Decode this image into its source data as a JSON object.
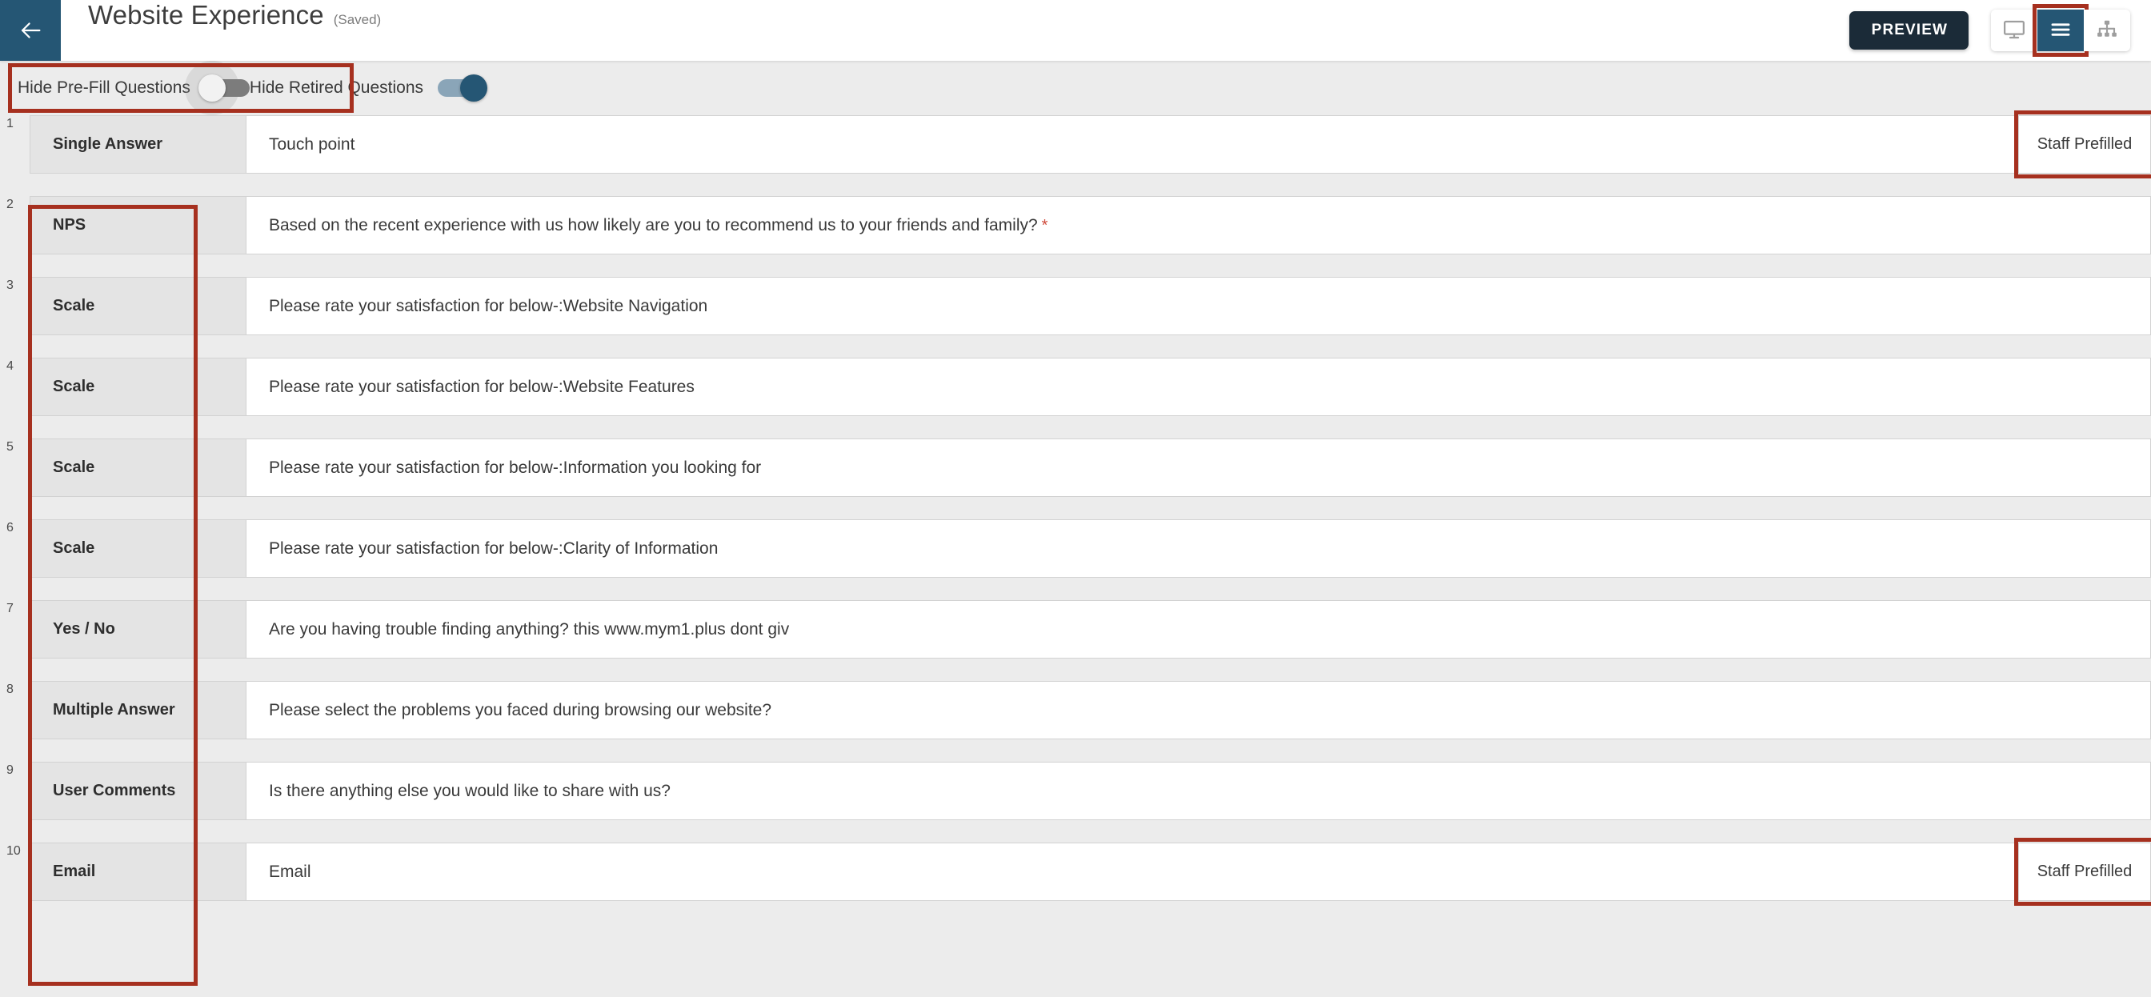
{
  "header": {
    "back_icon": "arrow-left-icon",
    "title": "Website Experience",
    "saved_status": "(Saved)",
    "preview_label": "PREVIEW",
    "view_modes": [
      {
        "name": "desktop-view",
        "icon": "monitor-icon",
        "active": false
      },
      {
        "name": "list-view",
        "icon": "hamburger-list-icon",
        "active": true
      },
      {
        "name": "flow-view",
        "icon": "sitemap-tree-icon",
        "active": false
      }
    ]
  },
  "filters": {
    "hide_prefill_label": "Hide Pre-Fill Questions",
    "hide_prefill_on": false,
    "hide_retired_label": "Hide Retired Questions",
    "hide_retired_on": true
  },
  "colors": {
    "brand_blue": "#255674",
    "preview_dark": "#1b2b38",
    "annotation_red": "#a6301f",
    "required_star": "#cf4b3c",
    "row_type_bg": "#e4e4e4",
    "page_bg": "#ececec"
  },
  "badges": {
    "staff_prefilled": "Staff Prefilled"
  },
  "questions": [
    {
      "number": "1",
      "type": "Single Answer",
      "text": "Touch point",
      "required": false,
      "prefilled": true
    },
    {
      "number": "2",
      "type": "NPS",
      "text": "Based on the recent experience with us how likely are you to recommend us to your friends and family?",
      "required": true,
      "prefilled": false
    },
    {
      "number": "3",
      "type": "Scale",
      "text": "Please rate your satisfaction for below-:Website Navigation",
      "required": false,
      "prefilled": false
    },
    {
      "number": "4",
      "type": "Scale",
      "text": "Please rate your satisfaction for below-:Website Features",
      "required": false,
      "prefilled": false
    },
    {
      "number": "5",
      "type": "Scale",
      "text": "Please rate your satisfaction for below-:Information you looking for",
      "required": false,
      "prefilled": false
    },
    {
      "number": "6",
      "type": "Scale",
      "text": "Please rate your satisfaction for below-:Clarity of Information",
      "required": false,
      "prefilled": false
    },
    {
      "number": "7",
      "type": "Yes / No",
      "text": "Are you having trouble finding anything? this www.mym1.plus dont giv",
      "required": false,
      "prefilled": false
    },
    {
      "number": "8",
      "type": "Multiple Answer",
      "text": "Please select the problems you faced during browsing our website?",
      "required": false,
      "prefilled": false
    },
    {
      "number": "9",
      "type": "User Comments",
      "text": "Is there anything else you would like to share with us?",
      "required": false,
      "prefilled": false
    },
    {
      "number": "10",
      "type": "Email",
      "text": "Email",
      "required": false,
      "prefilled": true
    }
  ]
}
